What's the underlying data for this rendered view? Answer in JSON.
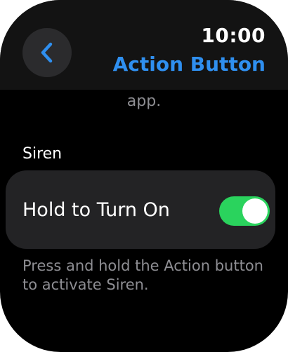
{
  "status_bar": {
    "time": "10:00"
  },
  "nav": {
    "title": "Action Button",
    "back_icon": "chevron-left-icon",
    "accent_color": "#2f8fef"
  },
  "content": {
    "clipped_text": "app.",
    "section_label": "Siren",
    "toggle_row": {
      "label": "Hold to Turn On",
      "toggle_state": "on",
      "toggle_color": "#2ad35d"
    },
    "footnote": "Press and hold the Action button to activate Siren."
  }
}
